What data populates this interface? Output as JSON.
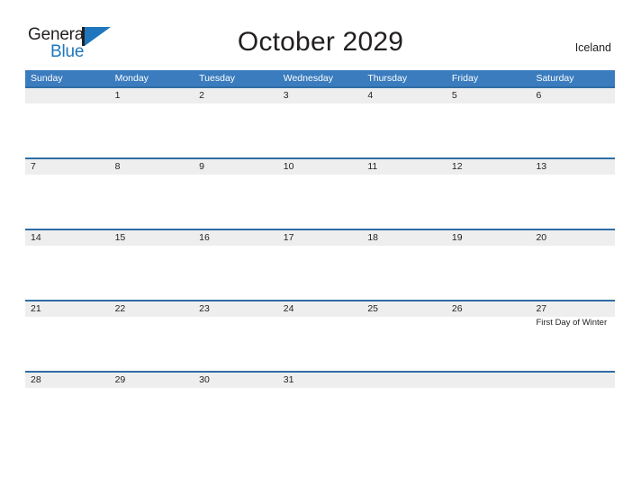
{
  "brand": {
    "name_part1": "General",
    "name_part2": "Blue",
    "mark_icon": "triangle-flag-icon",
    "color_primary": "#1f76bc",
    "color_text": "#231f20"
  },
  "header": {
    "title": "October 2029",
    "locale": "Iceland"
  },
  "calendar": {
    "header_bg": "#3a7cbe",
    "row_band_bg": "#eeeeee",
    "row_border": "#2e6da4",
    "weekdays": [
      "Sunday",
      "Monday",
      "Tuesday",
      "Wednesday",
      "Thursday",
      "Friday",
      "Saturday"
    ],
    "weeks": [
      {
        "days": [
          {
            "date": ""
          },
          {
            "date": "1"
          },
          {
            "date": "2"
          },
          {
            "date": "3"
          },
          {
            "date": "4"
          },
          {
            "date": "5"
          },
          {
            "date": "6"
          }
        ]
      },
      {
        "days": [
          {
            "date": "7"
          },
          {
            "date": "8"
          },
          {
            "date": "9"
          },
          {
            "date": "10"
          },
          {
            "date": "11"
          },
          {
            "date": "12"
          },
          {
            "date": "13"
          }
        ]
      },
      {
        "days": [
          {
            "date": "14"
          },
          {
            "date": "15"
          },
          {
            "date": "16"
          },
          {
            "date": "17"
          },
          {
            "date": "18"
          },
          {
            "date": "19"
          },
          {
            "date": "20"
          }
        ]
      },
      {
        "days": [
          {
            "date": "21"
          },
          {
            "date": "22"
          },
          {
            "date": "23"
          },
          {
            "date": "24"
          },
          {
            "date": "25"
          },
          {
            "date": "26"
          },
          {
            "date": "27",
            "events": [
              "First Day of Winter"
            ]
          }
        ]
      },
      {
        "days": [
          {
            "date": "28"
          },
          {
            "date": "29"
          },
          {
            "date": "30"
          },
          {
            "date": "31"
          },
          {
            "date": ""
          },
          {
            "date": ""
          },
          {
            "date": ""
          }
        ]
      }
    ]
  }
}
